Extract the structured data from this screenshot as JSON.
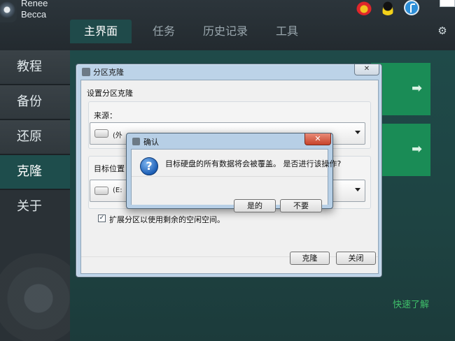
{
  "app": {
    "brand_line1": "Renee",
    "brand_line2": "Becca",
    "tabs": [
      {
        "label": "主界面"
      },
      {
        "label": "任务"
      },
      {
        "label": "历史记录"
      },
      {
        "label": "工具"
      }
    ],
    "social_icons": [
      "weibo-icon",
      "qq-icon",
      "facebook-icon"
    ]
  },
  "sidebar": {
    "items": [
      {
        "label": "教程"
      },
      {
        "label": "备份"
      },
      {
        "label": "还原"
      },
      {
        "label": "克隆",
        "active": true
      },
      {
        "label": "关于"
      }
    ]
  },
  "main": {
    "quick_link": "快速了解",
    "accent_color": "#1a8c56"
  },
  "clone_dialog": {
    "title": "分区克隆",
    "heading": "设置分区克隆",
    "source_label": "来源：",
    "source_value": "(外",
    "target_label": "目标位置",
    "target_value": "(E:",
    "checkbox_label": "扩展分区以使用剩余的空闲空间。",
    "checkbox_checked": true,
    "clone_button": "克隆",
    "close_button": "关闭"
  },
  "confirm_dialog": {
    "title": "确认",
    "message": "目标硬盘的所有数据将会被覆盖。 是否进行该操作?",
    "yes_button": "是的",
    "no_button": "不要"
  }
}
